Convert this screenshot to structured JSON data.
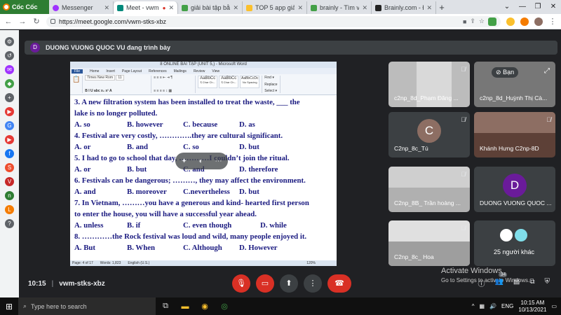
{
  "browser": {
    "brand": "Cốc Cốc",
    "tabs": [
      {
        "label": "Messenger",
        "color": "#a033ff"
      },
      {
        "label": "Meet - vwm",
        "color": "#00897b",
        "active": true
      },
      {
        "label": "giải bài tập bằng",
        "color": "#43a047"
      },
      {
        "label": "TOP 5 app giải T",
        "color": "#fbc02d"
      },
      {
        "label": "brainly - Tìm với",
        "color": "#43a047"
      },
      {
        "label": "Brainly.com - Đi",
        "color": "#222222"
      }
    ],
    "url": "https://meet.google.com/vwm-stks-xbz"
  },
  "meet": {
    "presenter_initial": "D",
    "presenter_text": "DUONG VUONG QUOC VU đang trình bày",
    "time": "10:15",
    "meeting_code": "vwm-stks-xbz",
    "participants": [
      {
        "name": "c2np_8d_Phạm Đăng ..."
      },
      {
        "name": "c2np_8d_Huỳnh Thị Cà...",
        "badge": "Bạn"
      },
      {
        "name": "C2np_8c_Tú",
        "initial": "C"
      },
      {
        "name": "Khánh Hưng C2np-8D"
      },
      {
        "name": "C2np_8B_ Trần hoàng ..."
      },
      {
        "name": "DUONG VUONG QUOC ...",
        "initial": "D"
      },
      {
        "name": "C2np_8c_ Hoa"
      },
      {
        "name": "25 người khác"
      }
    ],
    "participant_count": "34",
    "activate_title": "Activate Windows",
    "activate_sub": "Go to Settings to activate Windows."
  },
  "word": {
    "title": "8 ONLINE BÀI TẬP (UNIT 5,) - Microsoft Word",
    "menu": [
      "File",
      "Home",
      "Insert",
      "Page Layout",
      "References",
      "Mailings",
      "Review",
      "View"
    ],
    "font": "Times New Rom",
    "font_size": "11",
    "styles": [
      "AaBbCc",
      "AaBbCc",
      "AaBbCcDc"
    ],
    "style_names": [
      "¶ Char Ch...",
      "¶ Char Ch...",
      "No Spacing"
    ],
    "lines": [
      "3. A new filtration system has been installed to treat the waste, ___ the",
      "lake is no longer polluted.",
      "4. Festival are very costly, ………….they are cultural significant.",
      "5. I had to go to school that day, …………I couldn’t join the ritual.",
      "6. Festivals can be dangerous; ………, they may affect the environment.",
      "7. In Vietnam, ………you have a generous and kind- hearted  first person",
      "to enter the house, you will have a successful year ahead.",
      "8. …………the Rock festival was loud and wild, many people enjoyed it."
    ],
    "options_3": [
      "A. so",
      "B. however",
      "C. because",
      "D. as"
    ],
    "options_4": [
      "A. or",
      "B. and",
      "C. so",
      "D. but"
    ],
    "options_5": [
      "A. or",
      "B. but",
      "C. and",
      "D. therefore"
    ],
    "options_6": [
      "A. and",
      "B. moreover",
      "C.nevertheless",
      "D. but"
    ],
    "options_7": [
      "A. unless",
      "B. if",
      "C. even though",
      "D. while"
    ],
    "options_8": [
      "A. But",
      "B. When",
      "C. Although",
      "D. However"
    ],
    "status": [
      "Page: 4 of 17",
      "Words: 1,823",
      "English (U.S.)"
    ],
    "zoom": "120%"
  },
  "taskbar": {
    "search_placeholder": "Type here to search",
    "lang": "ENG",
    "time": "10:15 AM",
    "date": "10/13/2021"
  }
}
